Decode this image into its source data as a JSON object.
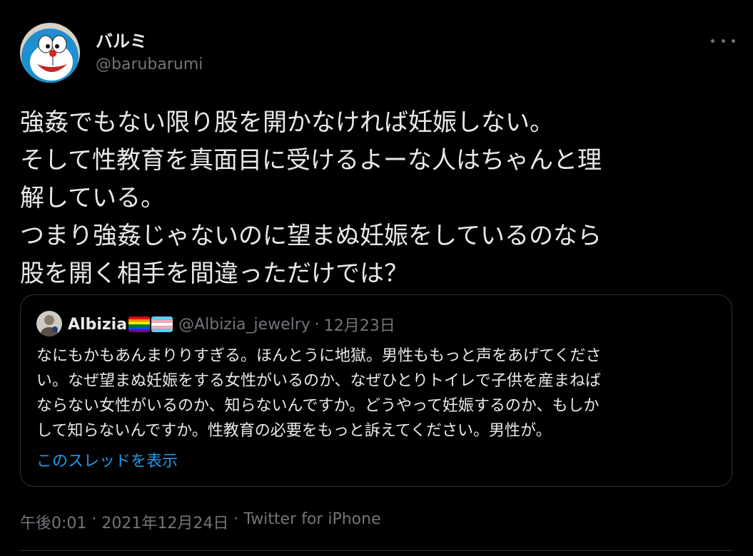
{
  "tweet": {
    "display_name": "バルミ",
    "handle": "@barubarumi",
    "text_lines": [
      "強姦でもない限り股を開かなければ妊娠しない。",
      "そして性教育を真面目に受けるよーな人はちゃんと理",
      "解している。",
      "つまり強姦じゃないのに望まぬ妊娠をしているのなら",
      "股を開く相手を間違っただけでは？"
    ],
    "time": "午後0:01",
    "date": "2021年12月24日",
    "source": "Twitter for iPhone",
    "separator": "·"
  },
  "quoted_tweet": {
    "display_name": "Albizia",
    "flags": [
      "rainbow-flag-icon",
      "transgender-flag-icon"
    ],
    "handle": "@Albizia_jewelry",
    "separator": "·",
    "date": "12月23日",
    "text_lines": [
      "なにもかもあんまりりすぎる。ほんとうに地獄。男性ももっと声をあげてくださ",
      "い。なぜ望まぬ妊娠をする女性がいるのか、なぜひとりトイレで子供を産まねば",
      "ならない女性がいるのか、知らないんですか。どうやって妊娠するのか、もしか",
      "して知らないんですか。性教育の必要をもっと訴えてください。男性が。"
    ],
    "show_thread_label": "このスレッドを表示"
  },
  "colors": {
    "background": "#000000",
    "text": "#e7e9ea",
    "secondary": "#71767b",
    "link": "#1d9bf0",
    "border": "#2f3336"
  }
}
